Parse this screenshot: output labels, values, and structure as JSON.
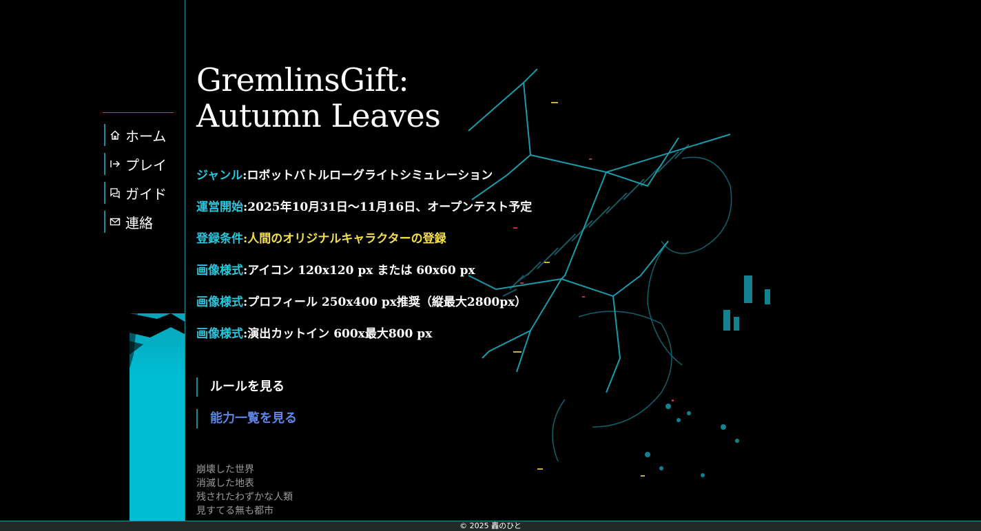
{
  "nav": {
    "items": [
      {
        "label": "ホーム",
        "icon": "home-icon"
      },
      {
        "label": "プレイ",
        "icon": "login-arrow-icon"
      },
      {
        "label": "ガイド",
        "icon": "guide-chat-icon"
      },
      {
        "label": "連絡",
        "icon": "mail-icon"
      }
    ]
  },
  "main": {
    "title_line1": "GremlinsGift:",
    "title_line2": "Autumn Leaves",
    "info": [
      {
        "label": "ジャンル",
        "value": "ロボットバトルローグライトシミュレーション"
      },
      {
        "label": "運営開始",
        "value": "2025年10月31日〜11月16日、オープンテスト予定"
      },
      {
        "label": "登録条件",
        "value": "人間のオリジナルキャラクターの登録"
      },
      {
        "label": "画像様式",
        "value": "アイコン 120x120 px または 60x60 px"
      },
      {
        "label": "画像様式",
        "value": "プロフィール 250x400 px推奨（縦最大2800px）"
      },
      {
        "label": "画像様式",
        "value": "演出カットイン 600x最大800 px"
      }
    ],
    "links": {
      "rules": "ルールを見る",
      "abilities": "能力一覧を見る"
    },
    "story": [
      "崩壊した世界",
      "消滅した地表",
      "残されたわずかな人類",
      "見すてる無も都市"
    ]
  },
  "footer": {
    "copyright": "© 2025 轟のひと"
  },
  "colors": {
    "accent": "#29c7dd",
    "highlight": "#f5e14a",
    "link": "#5d86e8",
    "paint": "#00bcd4"
  }
}
